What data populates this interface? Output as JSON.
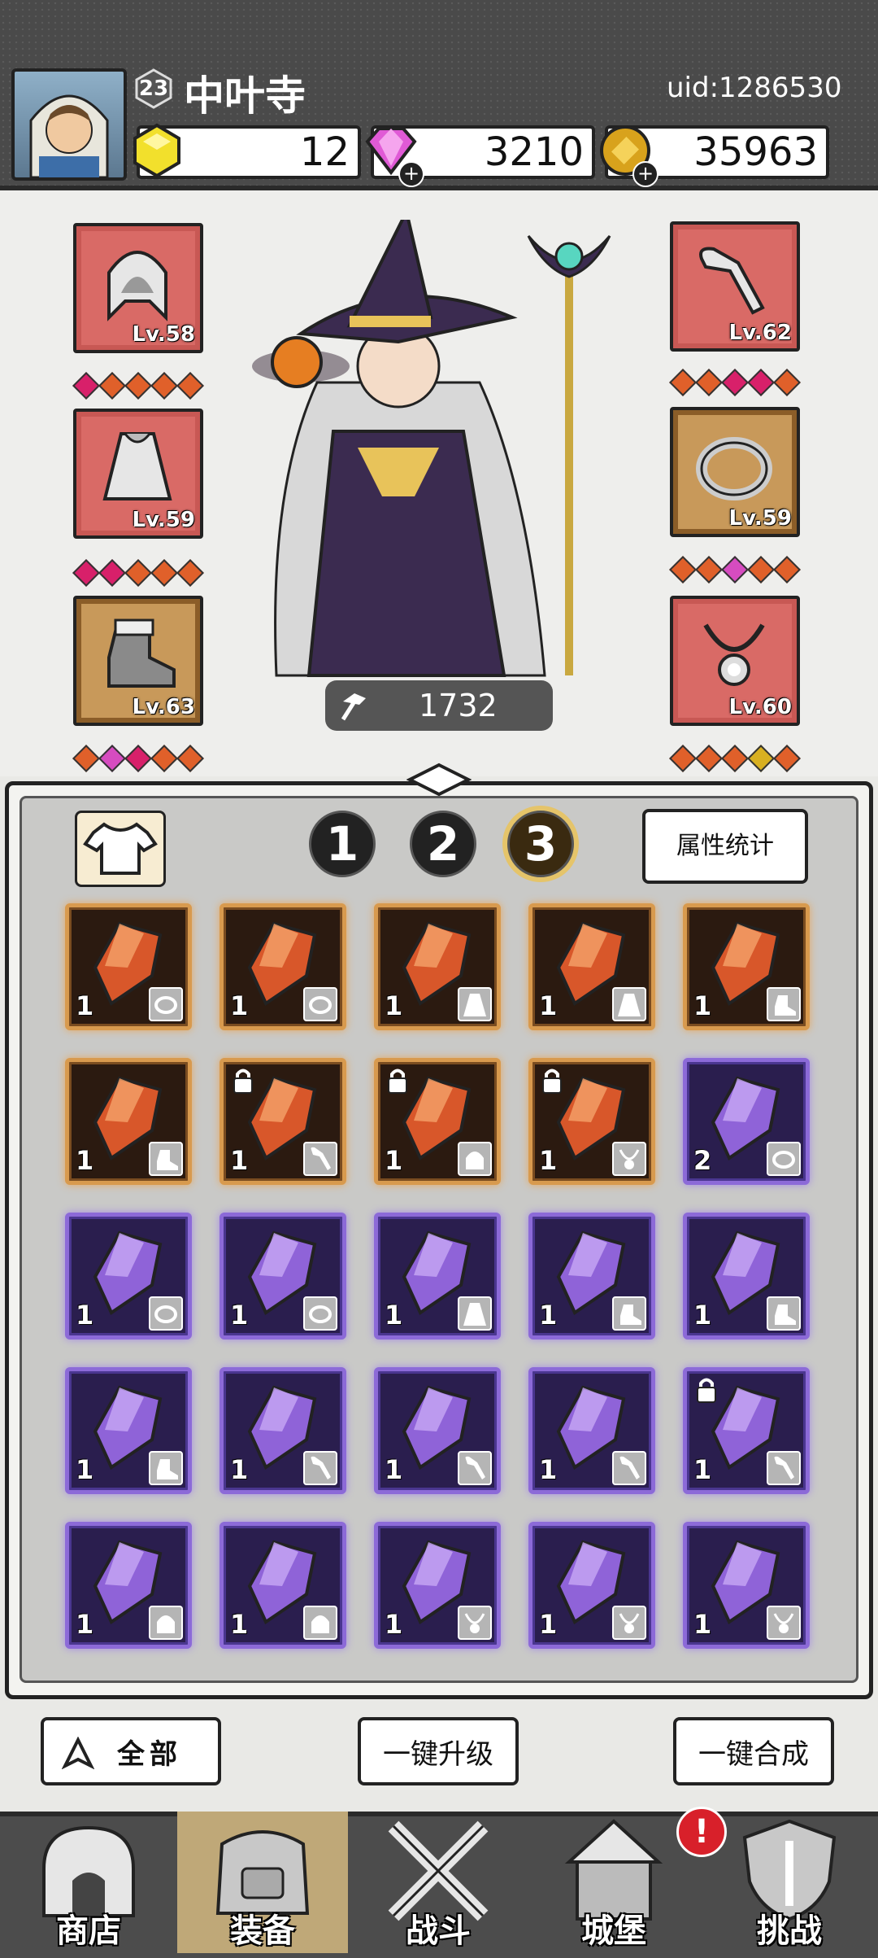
{
  "header": {
    "player_level": "23",
    "player_name": "中叶寺",
    "uid": "uid:1286530",
    "currencies": [
      {
        "icon": "yellow-gem-icon",
        "value": "12",
        "color": "#f2e02c",
        "has_plus": false
      },
      {
        "icon": "pink-diamond-icon",
        "value": "3210",
        "color": "#e05ad6",
        "has_plus": true
      },
      {
        "icon": "gold-coin-icon",
        "value": "35963",
        "color": "#d8a21c",
        "has_plus": true
      }
    ]
  },
  "equipment": {
    "left": [
      {
        "item": "hood-icon",
        "level": "Lv.58",
        "frame": "red"
      },
      {
        "item": "cape-icon",
        "level": "Lv.59",
        "frame": "red"
      },
      {
        "item": "boot-icon",
        "level": "Lv.63",
        "frame": "gold"
      }
    ],
    "right": [
      {
        "item": "bone-weapon-icon",
        "level": "Lv.62",
        "frame": "red"
      },
      {
        "item": "ring-icon",
        "level": "Lv.59",
        "frame": "gold"
      },
      {
        "item": "necklace-icon",
        "level": "Lv.60",
        "frame": "red"
      }
    ],
    "gem_rows": [
      [
        "#d8206a",
        "#e0602a",
        "#e0602a",
        "#e0602a",
        "#e0602a"
      ],
      [
        "#d8206a",
        "#d8206a",
        "#e0602a",
        "#e0602a",
        "#e0602a"
      ],
      [
        "#e0602a",
        "#d64cc0",
        "#d8206a",
        "#e0602a",
        "#e0602a"
      ],
      [
        "#e0602a",
        "#e0602a",
        "#d8206a",
        "#d8206a",
        "#e0602a"
      ],
      [
        "#e0602a",
        "#e0602a",
        "#d64cc0",
        "#e0602a",
        "#e0602a"
      ],
      [
        "#e0602a",
        "#e0602a",
        "#e0602a",
        "#d8b020",
        "#e0602a"
      ]
    ],
    "power": "1732"
  },
  "inventory": {
    "set_tabs": [
      "1",
      "2",
      "3"
    ],
    "active_tab": "3",
    "stats_button": "属性统计",
    "items": [
      {
        "rarity": "orange",
        "qty": "1",
        "slot": "ring",
        "locked": false
      },
      {
        "rarity": "orange",
        "qty": "1",
        "slot": "ring",
        "locked": false
      },
      {
        "rarity": "orange",
        "qty": "1",
        "slot": "cape",
        "locked": false
      },
      {
        "rarity": "orange",
        "qty": "1",
        "slot": "cape",
        "locked": false
      },
      {
        "rarity": "orange",
        "qty": "1",
        "slot": "boot",
        "locked": false
      },
      {
        "rarity": "orange",
        "qty": "1",
        "slot": "boot",
        "locked": false
      },
      {
        "rarity": "orange",
        "qty": "1",
        "slot": "weapon",
        "locked": true
      },
      {
        "rarity": "orange",
        "qty": "1",
        "slot": "hood",
        "locked": true
      },
      {
        "rarity": "orange",
        "qty": "1",
        "slot": "necklace",
        "locked": true
      },
      {
        "rarity": "purple",
        "qty": "2",
        "slot": "ring",
        "locked": false
      },
      {
        "rarity": "purple",
        "qty": "1",
        "slot": "ring",
        "locked": false
      },
      {
        "rarity": "purple",
        "qty": "1",
        "slot": "ring",
        "locked": false
      },
      {
        "rarity": "purple",
        "qty": "1",
        "slot": "cape",
        "locked": false
      },
      {
        "rarity": "purple",
        "qty": "1",
        "slot": "boot",
        "locked": false
      },
      {
        "rarity": "purple",
        "qty": "1",
        "slot": "boot",
        "locked": false
      },
      {
        "rarity": "purple",
        "qty": "1",
        "slot": "boot",
        "locked": false
      },
      {
        "rarity": "purple",
        "qty": "1",
        "slot": "weapon",
        "locked": false
      },
      {
        "rarity": "purple",
        "qty": "1",
        "slot": "weapon",
        "locked": false
      },
      {
        "rarity": "purple",
        "qty": "1",
        "slot": "weapon",
        "locked": false
      },
      {
        "rarity": "purple",
        "qty": "1",
        "slot": "weapon",
        "locked": true
      },
      {
        "rarity": "purple",
        "qty": "1",
        "slot": "hood",
        "locked": false
      },
      {
        "rarity": "purple",
        "qty": "1",
        "slot": "hood",
        "locked": false
      },
      {
        "rarity": "purple",
        "qty": "1",
        "slot": "necklace",
        "locked": false
      },
      {
        "rarity": "purple",
        "qty": "1",
        "slot": "necklace",
        "locked": false
      },
      {
        "rarity": "purple",
        "qty": "1",
        "slot": "necklace",
        "locked": false
      }
    ]
  },
  "actions": {
    "filter_label": "全部",
    "upgrade_label": "一键升级",
    "merge_label": "一键合成"
  },
  "nav": {
    "items": [
      {
        "label": "商店",
        "icon": "shop-icon"
      },
      {
        "label": "装备",
        "icon": "backpack-icon"
      },
      {
        "label": "战斗",
        "icon": "crossed-swords-icon"
      },
      {
        "label": "城堡",
        "icon": "castle-icon"
      },
      {
        "label": "挑战",
        "icon": "shield-icon"
      }
    ],
    "active": "装备",
    "alert_badge": "!"
  }
}
